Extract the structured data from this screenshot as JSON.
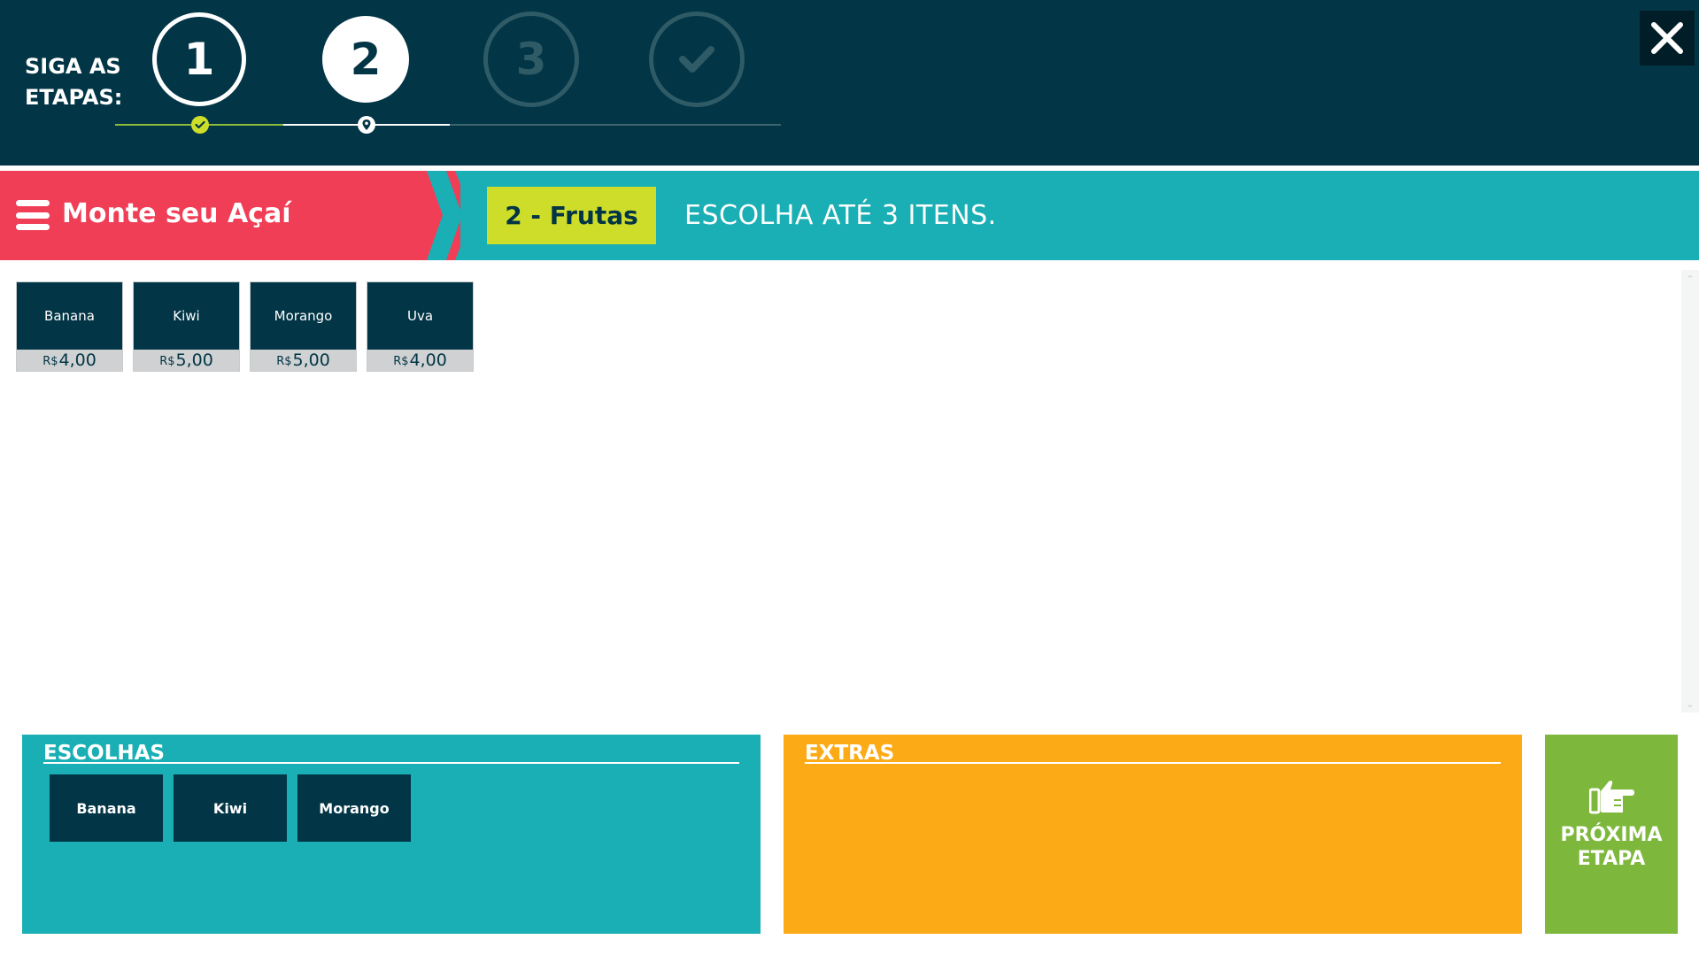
{
  "colors": {
    "header_bg": "#023546",
    "title_tab": "#f03e56",
    "section_bar": "#1aafb4",
    "step_pill": "#cddd2a",
    "extras_panel": "#fcab16",
    "next_button": "#7db83c"
  },
  "stepper": {
    "label_line1": "SIGA AS",
    "label_line2": "ETAPAS:",
    "steps": [
      {
        "label": "1",
        "state": "done"
      },
      {
        "label": "2",
        "state": "current"
      },
      {
        "label": "3",
        "state": "pending"
      },
      {
        "label": "",
        "icon": "check-icon",
        "state": "pending"
      }
    ],
    "close_icon": "close-icon"
  },
  "section": {
    "menu_icon": "hamburger-icon",
    "title": "Monte seu Açaí",
    "step_name": "2 - Frutas",
    "hint": "ESCOLHA ATÉ 3 ITENS."
  },
  "products": [
    {
      "name": "Banana",
      "currency": "R$",
      "price": "4,00"
    },
    {
      "name": "Kiwi",
      "currency": "R$",
      "price": "5,00"
    },
    {
      "name": "Morango",
      "currency": "R$",
      "price": "5,00"
    },
    {
      "name": "Uva",
      "currency": "R$",
      "price": "4,00"
    }
  ],
  "choices": {
    "title": "ESCOLHAS",
    "items": [
      "Banana",
      "Kiwi",
      "Morango"
    ]
  },
  "extras": {
    "title": "EXTRAS",
    "items": []
  },
  "next_button": {
    "icon": "pointing-hand-icon",
    "label_line1": "PRÓXIMA",
    "label_line2": "ETAPA"
  }
}
